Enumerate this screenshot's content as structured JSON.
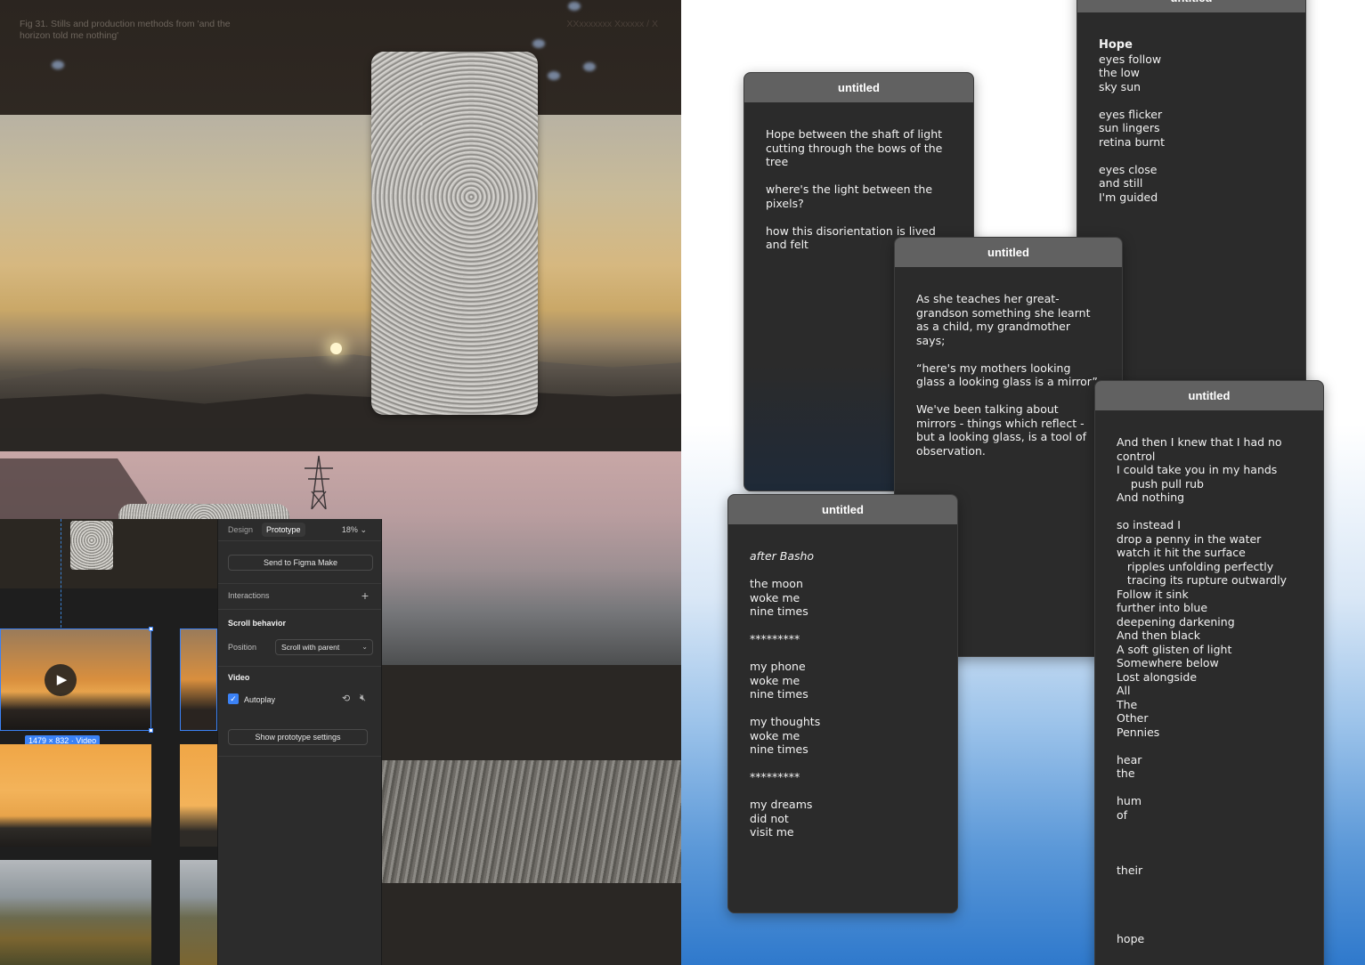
{
  "collage": {
    "caption": "Fig 31. Stills and production methods from 'and the horizon told me nothing'",
    "figure_ref": "XXxxxxxxx Xxxxxx / X"
  },
  "canvas": {
    "dimension_badge": "1479 × 832 · Video",
    "play_icon": "▶"
  },
  "panel": {
    "tabs": [
      "Design",
      "Prototype"
    ],
    "active_tab": "Prototype",
    "zoom": "18%",
    "send_button": "Send to Figma Make",
    "interactions_label": "Interactions",
    "scroll_behavior_title": "Scroll behavior",
    "position_label": "Position",
    "position_value": "Scroll with parent",
    "video_title": "Video",
    "autoplay_label": "Autoplay",
    "autoplay_checked": true,
    "show_settings_button": "Show prototype settings",
    "accent_color": "#3b82f6"
  },
  "windows": [
    {
      "title": "untitled",
      "lines": "Hope\n\neyes follow\nthe low\nsky sun\n\neyes flicker\nsun lingers\nretina burnt\n\neyes close\nand still\nI'm guided"
    },
    {
      "title": "untitled",
      "lines": "Hope between the shaft of light cutting through the bows of the tree\n\nwhere's the light between the pixels?\n\nhow this disorientation is lived and felt"
    },
    {
      "title": "untitled",
      "lines": "As she teaches her great-grandson something she learnt as a child, my grandmother says;\n\n“here's my mothers looking glass a looking glass is a mirror”\n\nWe've been talking about mirrors - things which reflect - but a looking glass, is a tool of observation."
    },
    {
      "title": "untitled",
      "subtitle": "after Basho",
      "lines": "the moon\nwoke me\nnine times\n\n*********\n\nmy phone\nwoke me\nnine times\n\nmy thoughts\nwoke me\nnine times\n\n*********\n\nmy dreams\ndid not\nvisit me"
    },
    {
      "title": "untitled",
      "lines": "And then I knew that I had no control\nI could take you in my hands\n    push pull rub\nAnd nothing\n\nso instead I\ndrop a penny in the water\nwatch it hit the surface\n   ripples unfolding perfectly\n   tracing its rupture outwardly\nFollow it sink\nfurther into blue\ndeepening darkening\nAnd then black\nA soft glisten of light\nSomewhere below\nLost alongside\nAll\nThe\nOther\nPennies\n\nhear\nthe\n\nhum\nof\n\n\n\ntheir\n\n\n\n\nhope"
    }
  ]
}
